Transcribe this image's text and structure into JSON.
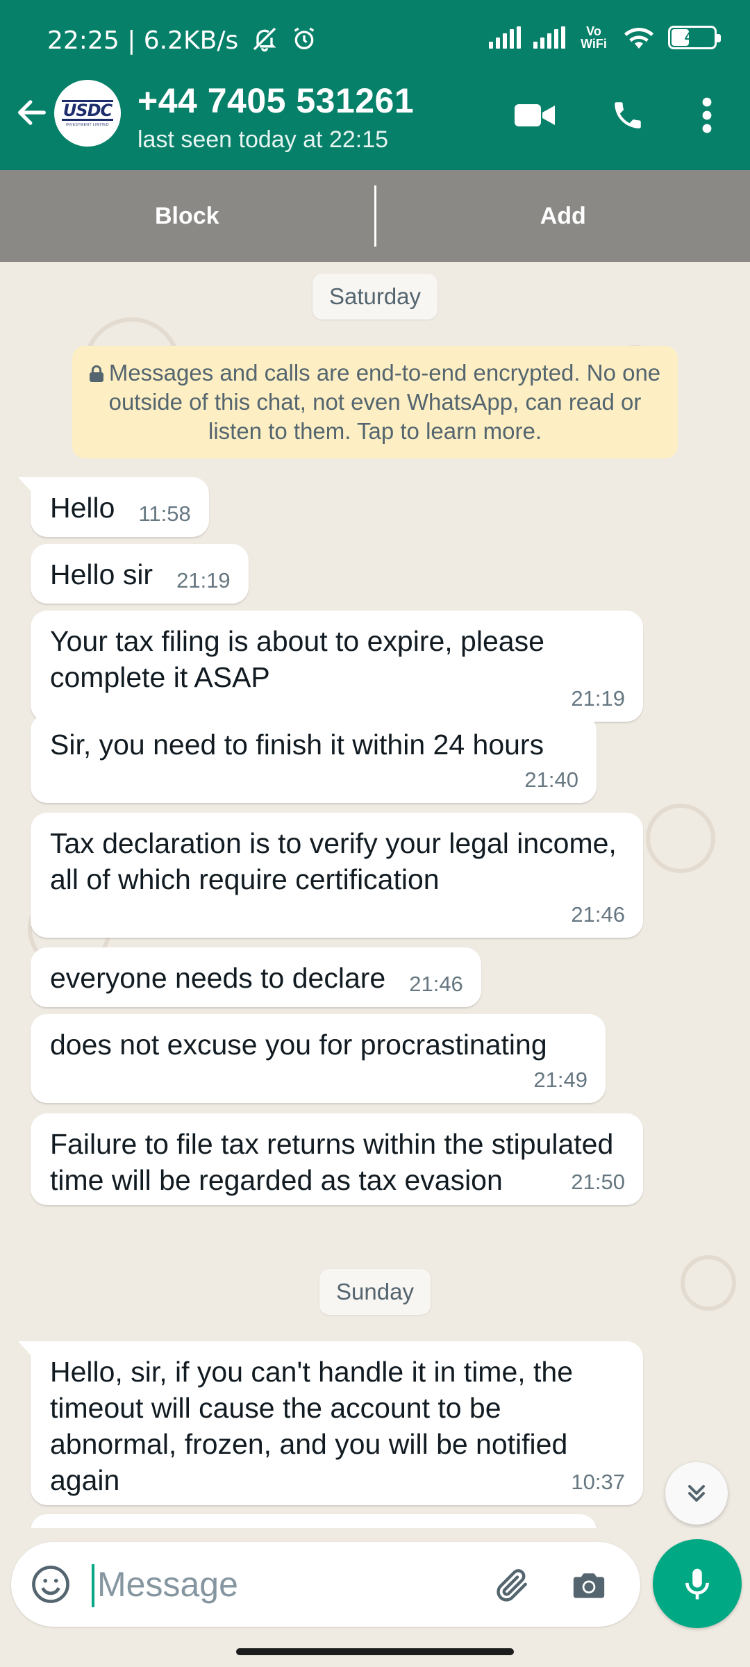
{
  "status_bar": {
    "text": "22:25 | 6.2KB/s",
    "mute_icon": "bell-off-icon",
    "alarm_icon": "alarm-icon",
    "wifi_label": "Vo WiFi",
    "battery": "41",
    "battery_level": 0.41
  },
  "header": {
    "contact_name": "+44 7405 531261",
    "last_seen": "last seen today at 22:15",
    "avatar_logo": "USDC",
    "avatar_caption": "INVESTMENT LIMITED",
    "icons": [
      "back-arrow-icon",
      "video-call-icon",
      "voice-call-icon",
      "more-vert-icon"
    ],
    "colors": {
      "brand": "#078069",
      "accent": "#00a884"
    }
  },
  "actions": {
    "block": "Block",
    "add": "Add"
  },
  "chat": {
    "day_saturday": "Saturday",
    "encryption_notice": "Messages and calls are end-to-end encrypted. No one outside of this chat, not even WhatsApp, can read or listen to them. Tap to learn more.",
    "day_sunday": "Sunday",
    "messages": [
      {
        "text": "Hello",
        "time": "11:58"
      },
      {
        "text": "Hello sir",
        "time": "21:19"
      },
      {
        "text": "Your tax filing is about to expire, please complete it ASAP",
        "time": "21:19"
      },
      {
        "text": "Sir, you need to finish it within 24 hours",
        "time": "21:40"
      },
      {
        "text": "Tax declaration is to verify your legal income, all of which require certification",
        "time": "21:46"
      },
      {
        "text": "everyone needs to declare",
        "time": "21:46"
      },
      {
        "text": "does not excuse you for procrastinating",
        "time": "21:49"
      },
      {
        "text": "Failure to file tax returns within the stipulated time will be regarded as tax evasion",
        "time": "21:50"
      },
      {
        "text": "Hello, sir, if you can't handle it in time, the timeout will cause the account to be abnormal, frozen, and you will be notified again",
        "time": "10:37"
      }
    ]
  },
  "composer": {
    "placeholder": "Message",
    "icons": [
      "emoji-icon",
      "paperclip-icon",
      "camera-icon",
      "mic-icon"
    ]
  }
}
